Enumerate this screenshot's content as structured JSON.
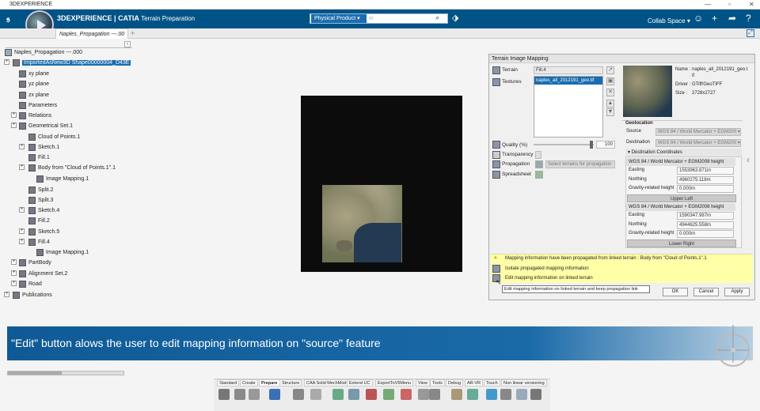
{
  "window": {
    "title": "3DEXPERIENCE"
  },
  "app": {
    "brand": "3DEXPERIENCE",
    "product": "CATIA",
    "app_name": "Terrain Preparation",
    "collab_space": "Collab Space"
  },
  "search": {
    "scope": "Physical Product",
    "placeholder": "in"
  },
  "tabs": [
    {
      "label": "Naples_Propagation ---.00"
    }
  ],
  "tree": {
    "root": "Naples_Propagation ---.000",
    "nodes": [
      {
        "label": "ImportedAsNew3D Shape00000004_D43E"
      },
      {
        "label": "xy plane"
      },
      {
        "label": "yz plane"
      },
      {
        "label": "zx plane"
      },
      {
        "label": "Parameters"
      },
      {
        "label": "Relations"
      },
      {
        "label": "Geometrical Set.1"
      },
      {
        "label": "Cloud of Points.1"
      },
      {
        "label": "Sketch.1"
      },
      {
        "label": "Fill.1"
      },
      {
        "label": "Body from \"Cloud of Points.1\".1"
      },
      {
        "label": "Image Mapping.1"
      },
      {
        "label": "Split.2"
      },
      {
        "label": "Split.3"
      },
      {
        "label": "Sketch.4"
      },
      {
        "label": "Fill.2"
      },
      {
        "label": "Sketch.5"
      },
      {
        "label": "Fill.4"
      },
      {
        "label": "Image Mapping.1"
      },
      {
        "label": "PartBody"
      },
      {
        "label": "Alignment Set.2"
      },
      {
        "label": "Road"
      },
      {
        "label": "Publications"
      }
    ]
  },
  "panel": {
    "title": "Terrain Image Mapping",
    "terrain_label": "Terrain",
    "terrain_value": "Fill.4",
    "textures_label": "Textures",
    "texture_item": "naples_all_2012191_geo.tif",
    "quality_label": "Quality (%)",
    "quality_value": "100",
    "transparency_label": "Transparency",
    "propagation_label": "Propagation",
    "propagation_placeholder": "Select terrains for propagation",
    "spreadsheet_label": "Spreadsheet",
    "info": {
      "name_label": "Name :",
      "name_value": "naples_all_2012191_geo.t",
      "name_value2": "if",
      "driver_label": "Driver :",
      "driver_value": "GTiff/GeoTIFF",
      "size_label": "Size :",
      "size_value": "2728x2727"
    },
    "geolocation": {
      "title": "Geolocation",
      "source_label": "Source",
      "source_value": "WGS 84 / World Mercator + EGM200",
      "destination_label": "Destination",
      "destination_value": "WGS 84 / World Mercator + EGM200"
    },
    "dest_coords": {
      "title": "Destination Coordinates",
      "upper": {
        "crs": "WGS 84 / World Mercator + EGM2008 height",
        "easting_label": "Easting",
        "easting": "1553963.871m",
        "northing_label": "Northing",
        "northing": "4960275.118m",
        "gravity_label": "Gravity-related height",
        "gravity": "0.000m",
        "corner": "Upper Left"
      },
      "lower": {
        "crs": "WGS 84 / World Mercator + EGM2008 height",
        "easting_label": "Easting",
        "easting": "1590347.987m",
        "northing_label": "Northing",
        "northing": "4944625.558m",
        "gravity_label": "Gravity-related height",
        "gravity": "0.000m",
        "corner": "Lower Right"
      }
    },
    "warning": "Mapping information have been propagated from linked terrain : Body from \"Cloud of Points.1\".1",
    "isolate": "Isolate propagated mapping information",
    "edit": "Edit mapping information on linked terrain",
    "tooltip": "Edit mapping information on linked terrain and keep propagation link",
    "ok": "OK",
    "cancel": "Cancel",
    "apply": "Apply"
  },
  "caption": "\"Edit\" button alows the user to edit mapping information on \"source\" feature",
  "action_bar": {
    "tabs": [
      "Standard",
      "Create",
      "Prepare",
      "Structure",
      "CAA Solid MechMod",
      "Extend UC",
      "ExportToV5Menu",
      "View",
      "Tools",
      "Debug",
      "AR-VR",
      "Touch",
      "Non linear versioning"
    ],
    "active": "Prepare"
  },
  "colors": {
    "appbar": "#005386",
    "selection": "#1a6db0",
    "warning_bg": "#ffffa8",
    "caption": "#1a6aa8"
  }
}
